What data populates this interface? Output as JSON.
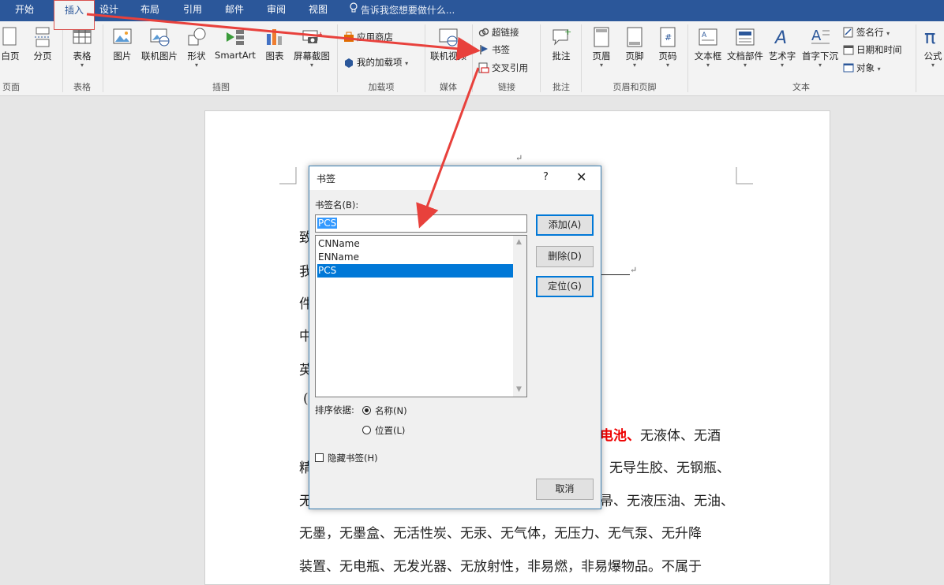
{
  "tabs": [
    "开始",
    "插入",
    "设计",
    "布局",
    "引用",
    "邮件",
    "审阅",
    "视图"
  ],
  "tell_me": "告诉我您想要做什么...",
  "ribbon": {
    "buttons": {
      "blank_page": "白页",
      "page_break": "分页",
      "table": "表格",
      "picture": "图片",
      "online_picture": "联机图片",
      "shapes": "形状",
      "smartart": "SmartArt",
      "chart": "图表",
      "screenshot": "屏幕截图",
      "store": "应用商店",
      "my_addins": "我的加载项",
      "online_video": "联机视频",
      "hyperlink": "超链接",
      "bookmark": "书签",
      "cross_reference": "交叉引用",
      "comment": "批注",
      "header": "页眉",
      "footer": "页脚",
      "page_number": "页码",
      "text_box": "文本框",
      "quick_parts": "文档部件",
      "wordart": "艺术字",
      "drop_cap": "首字下沉",
      "signature_line": "签名行",
      "date_time": "日期和时间",
      "object": "对象",
      "equation": "公式"
    },
    "groups": {
      "pages": "页面",
      "tables": "表格",
      "illustrations": "插图",
      "addins": "加载项",
      "media": "媒体",
      "links": "链接",
      "comments": "批注",
      "header_footer": "页眉和页脚",
      "text": "文本"
    }
  },
  "document": {
    "chars": [
      "致",
      "我",
      "件",
      "中",
      "英",
      "("
    ],
    "line1_red": "电池、",
    "line1": "无液体、无酒",
    "line2_left": "精",
    "line2": "无导生胶、无钢瓶、",
    "line3_left": "无",
    "line3": "帚、无液压油、无油、",
    "line4": "无墨，无墨盒、无活性炭、无汞、无气体，无压力、无气泵、无升降",
    "line5": "装置、无电瓶、无发光器、无放射性，非易燃，非易爆物品。不属于",
    "para_mark": "↵"
  },
  "dialog": {
    "title": "书签",
    "help": "?",
    "close": "✕",
    "name_label": "书签名(B):",
    "name_value": "PCS",
    "bookmarks": [
      "CNName",
      "ENName",
      "PCS"
    ],
    "selected_bookmark": "PCS",
    "buttons": {
      "add": "添加(A)",
      "delete": "删除(D)",
      "goto": "定位(G)",
      "cancel": "取消"
    },
    "sort_label": "排序依据:",
    "sort_name": "名称(N)",
    "sort_location": "位置(L)",
    "sort_selected": "名称(N)",
    "hidden_label": "隐藏书签(H)",
    "hidden_checked": false
  },
  "colors": {
    "titlebar": "#2b579a",
    "annotation": "#e8413c",
    "selection": "#0078d7"
  }
}
